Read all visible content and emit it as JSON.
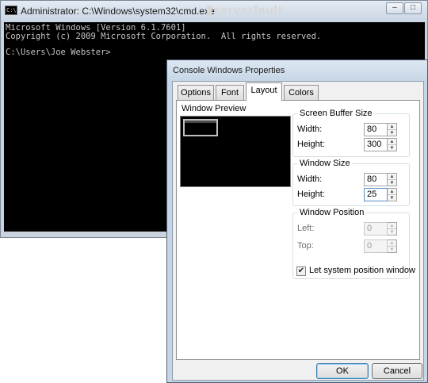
{
  "cmd": {
    "title": "Administrator: C:\\Windows\\system32\\cmd.exe",
    "icon": "C:\\",
    "watermark": "serverfault",
    "minimize_glyph": "–",
    "maximize_glyph": "□",
    "lines": [
      "Microsoft Windows [Version 6.1.7601]",
      "Copyright (c) 2009 Microsoft Corporation.  All rights reserved.",
      "",
      "C:\\Users\\Joe Webster>"
    ]
  },
  "dialog": {
    "title": "Console Windows Properties",
    "tabs": [
      {
        "label": "Options",
        "active": false
      },
      {
        "label": "Font",
        "active": false
      },
      {
        "label": "Layout",
        "active": true
      },
      {
        "label": "Colors",
        "active": false
      }
    ],
    "preview_label": "Window Preview",
    "buffer": {
      "label": "Screen Buffer Size",
      "width_label": "Width:",
      "width_value": "80",
      "height_label": "Height:",
      "height_value": "300"
    },
    "window_size": {
      "label": "Window Size",
      "width_label": "Width:",
      "width_value": "80",
      "height_label": "Height:",
      "height_value": "25"
    },
    "position": {
      "label": "Window Position",
      "left_label": "Left:",
      "left_value": "0",
      "top_label": "Top:",
      "top_value": "0"
    },
    "let_system_position": {
      "label": "Let system position window",
      "checked": true,
      "check_glyph": "✔"
    },
    "ok_label": "OK",
    "cancel_label": "Cancel"
  },
  "colors": {
    "console_bg": "#000000",
    "console_text": "#c4c4c4",
    "dialog_frame": "#c7d6e6"
  }
}
